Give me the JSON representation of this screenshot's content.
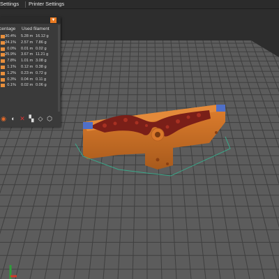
{
  "tabs": [
    "Settings",
    "Printer Settings"
  ],
  "filament_table": {
    "headers": [
      "rcentage",
      "Used filament"
    ],
    "rows": [
      {
        "pct": "30.4%",
        "length": "5.28 m",
        "weight": "16.12 g"
      },
      {
        "pct": "24.1%",
        "length": "2.57 m",
        "weight": "7.86 g"
      },
      {
        "pct": "0.0%",
        "length": "0.01 m",
        "weight": "0.02 g"
      },
      {
        "pct": "25.9%",
        "length": "3.67 m",
        "weight": "11.21 g"
      },
      {
        "pct": "7.8%",
        "length": "1.01 m",
        "weight": "3.08 g"
      },
      {
        "pct": "1.1%",
        "length": "0.12 m",
        "weight": "0.38 g"
      },
      {
        "pct": "1.2%",
        "length": "0.23 m",
        "weight": "0.72 g"
      },
      {
        "pct": "0.3%",
        "length": "0.04 m",
        "weight": "0.11 g"
      },
      {
        "pct": "0.1%",
        "length": "0.02 m",
        "weight": "0.06 g"
      }
    ]
  },
  "toolbar_icons": [
    "layers-icon",
    "color-icon",
    "erase-icon",
    "checkered-icon",
    "shell-icon",
    "cube-icon"
  ],
  "colors": {
    "accent": "#ea7a21",
    "model": "#d9782b",
    "bed": "#5c5c5c",
    "grid": "#3d3d3d",
    "outline": "#3aa88a"
  }
}
